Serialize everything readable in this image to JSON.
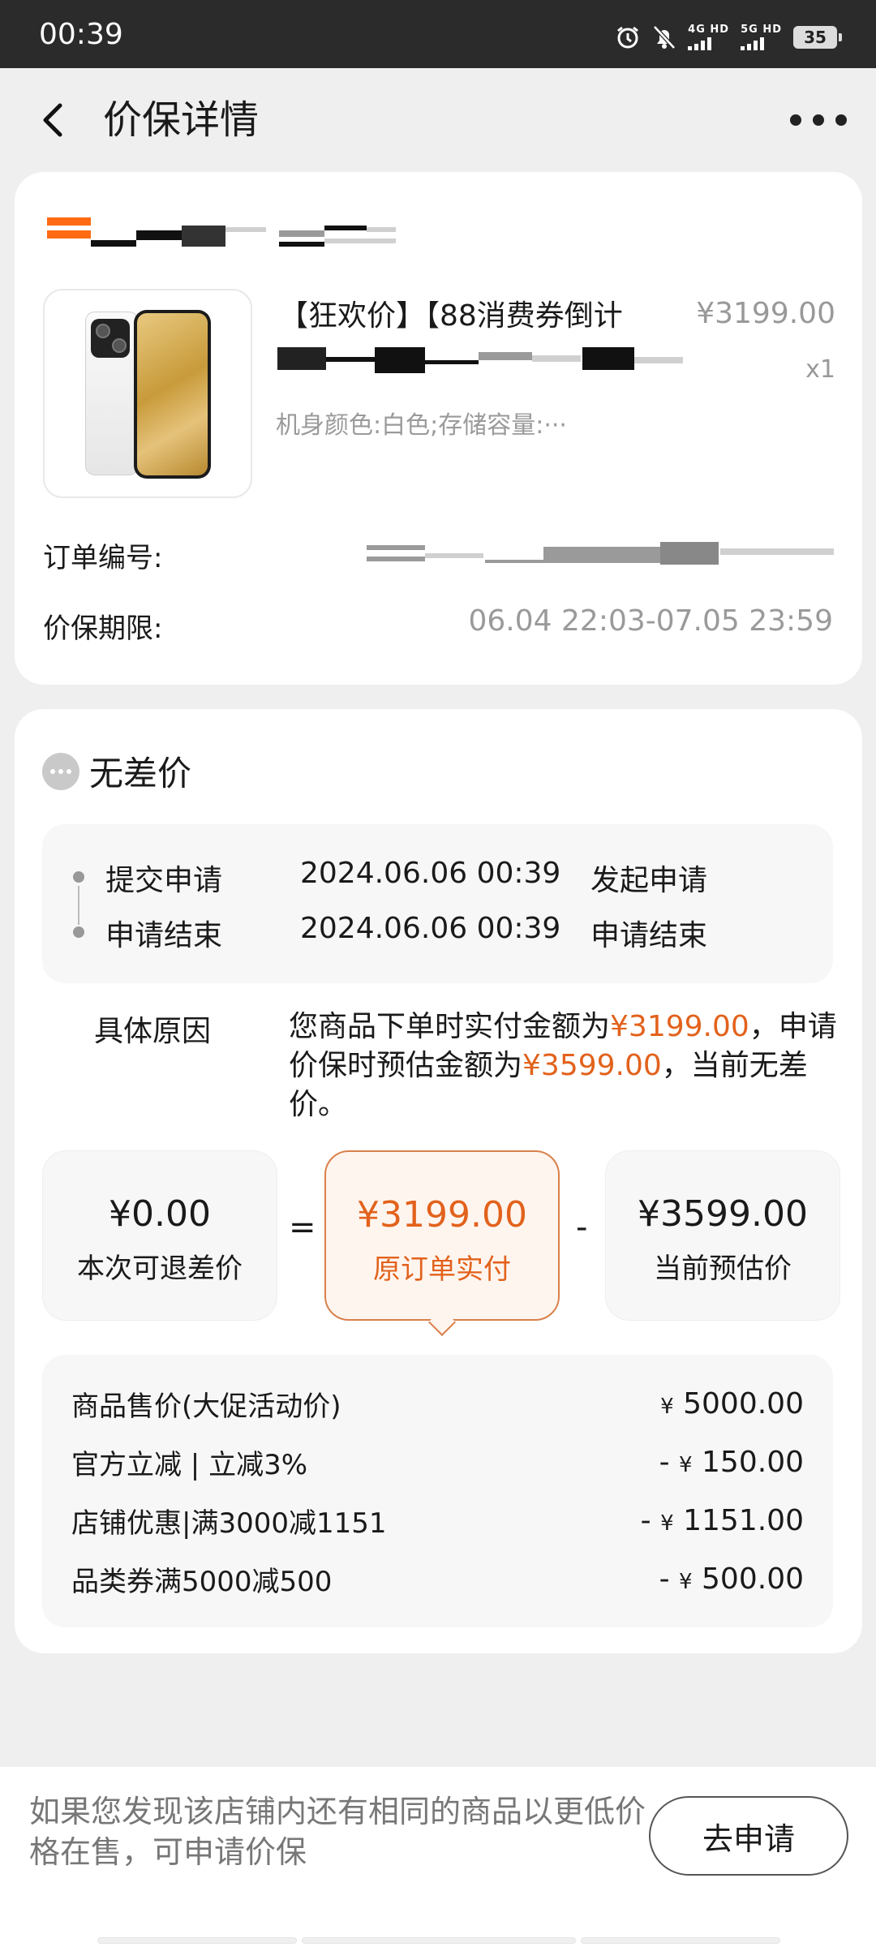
{
  "status_bar": {
    "time": "00:39",
    "net1": "4G HD",
    "net2": "5G HD",
    "battery": "35"
  },
  "nav": {
    "title": "价保详情"
  },
  "product": {
    "title": "【狂欢价】【88消费券倒计",
    "price": "¥3199.00",
    "qty": "x1",
    "spec": "机身颜色:白色;存储容量:···"
  },
  "order": {
    "order_no_label": "订单编号:",
    "period_label": "价保期限:",
    "period_value": "06.04 22:03-07.05 23:59"
  },
  "result": {
    "title": "无差价"
  },
  "timeline": [
    {
      "step": "提交申请",
      "time": "2024.06.06 00:39",
      "desc": "发起申请"
    },
    {
      "step": "申请结束",
      "time": "2024.06.06 00:39",
      "desc": "申请结束"
    }
  ],
  "reason": {
    "label": "具体原因",
    "part1": "您商品下单时实付金额为",
    "paid": "¥3199.00",
    "part2": "，申请价保时预估金额为",
    "estimate": "¥3599.00",
    "part3": "，当前无差价。"
  },
  "calc": {
    "refund_amount": "¥0.00",
    "refund_label": "本次可退差价",
    "eq": "=",
    "paid_amount": "¥3199.00",
    "paid_label": "原订单实付",
    "minus": "-",
    "estimate_amount": "¥3599.00",
    "estimate_label": "当前预估价"
  },
  "breakdown": [
    {
      "label": "商品售价(大促活动价)",
      "sign": "",
      "value": "5000.00"
    },
    {
      "label": "官方立减 | 立减3%",
      "sign": "-",
      "value": "150.00"
    },
    {
      "label": "店铺优惠|满3000减1151",
      "sign": "-",
      "value": "1151.00"
    },
    {
      "label": "品类券满5000减500",
      "sign": "-",
      "value": "500.00"
    }
  ],
  "currency_symbol": "¥",
  "footer": {
    "hint": "如果您发现该店铺内还有相同的商品以更低价格在售，可申请价保",
    "apply_label": "去申请"
  },
  "colors": {
    "accent": "#e2621c",
    "shop_logo": "#ff6a13"
  }
}
